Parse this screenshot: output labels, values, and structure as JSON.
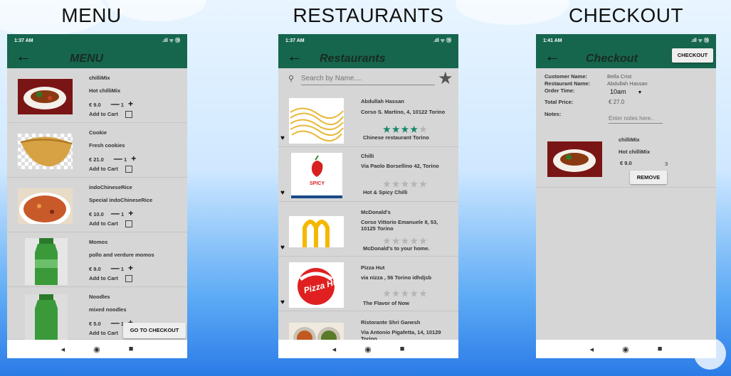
{
  "titles": {
    "menu": "MENU",
    "restaurants": "RESTAURANTS",
    "checkout": "CHECKOUT"
  },
  "status": {
    "time1": "1:37 AM",
    "time2": "1:37 AM",
    "time3": "1:41 AM",
    "icons": ".ıll ᯤ ⑲"
  },
  "nav": {
    "back": "◂",
    "home": "◉",
    "recents": "■"
  },
  "menu": {
    "title": "MENU",
    "go_checkout": "GO TO CHECKOUT",
    "add_label": "Add to Cart",
    "items": [
      {
        "name": "chilliMix",
        "desc": "Hot chilliMix",
        "price": "€ 9.0",
        "minus": "—",
        "qty": "1",
        "plus": "+"
      },
      {
        "name": "Cookie",
        "desc": "Fresh cookies",
        "price": "€ 21.0",
        "minus": "—",
        "qty": "1",
        "plus": "+"
      },
      {
        "name": "indoChineseRice",
        "desc": "Special indoChineseRice",
        "price": "€ 10.0",
        "minus": "—",
        "qty": "1",
        "plus": "+"
      },
      {
        "name": "Momos",
        "desc": "pollo and verdure momos",
        "price": "€ 9.0",
        "minus": "—",
        "qty": "1",
        "plus": "+"
      },
      {
        "name": "Noodles",
        "desc": "mixed noodles",
        "price": "€ 5.0",
        "minus": "—",
        "qty": "1",
        "plus": "+"
      }
    ]
  },
  "restaurants": {
    "title": "Restaurants",
    "search_placeholder": "Search by Name....",
    "items": [
      {
        "name": "Abdullah Hassan",
        "address": "Corso S. Martino, 4, 10122 Torino",
        "tagline": "Chinese restaurant Torino",
        "rating": 4
      },
      {
        "name": "Chilli",
        "address": "Via Paolo Borsellino 42, Torino",
        "tagline": "Hot & Spicy Chilli",
        "rating": 0,
        "logo": "SPICY"
      },
      {
        "name": "McDonald's",
        "address": "Corso Vittorio Emanuele II, 53, 10125 Torino",
        "tagline": "McDonald's to your home.",
        "rating": 0
      },
      {
        "name": "Pizza Hut",
        "address": "via nizza , 56 Torino idhdjsb",
        "tagline": "The Flavor of Now",
        "rating": 0,
        "logo": "Pizza Hut"
      },
      {
        "name": "Ristorante Shri Ganesh",
        "address": " Via Antonio Pigafetta, 14, 10129 Torino",
        "tagline": "",
        "rating": 0
      }
    ]
  },
  "checkout": {
    "title": "Checkout",
    "btn": "CHECKOUT",
    "customer_label": "Customer Name:",
    "customer": "Bella Crist",
    "restaurant_label": "Restaurant Name:",
    "restaurant": "Abdullah Hassan",
    "time_label": "Order Time:",
    "time": "10am",
    "price_label": "Total Price:",
    "price": "€ 27.0",
    "notes_label": "Notes:",
    "notes_placeholder": "Enter notes here..",
    "item": {
      "name": "chilliMix",
      "desc": "Hot chilliMix",
      "price": "€ 9.0",
      "qty": "3",
      "remove": "REMOVE"
    }
  },
  "colors": {
    "bar": "#16664e",
    "star_on": "#16866a",
    "star_off": "#b5b5b5"
  }
}
